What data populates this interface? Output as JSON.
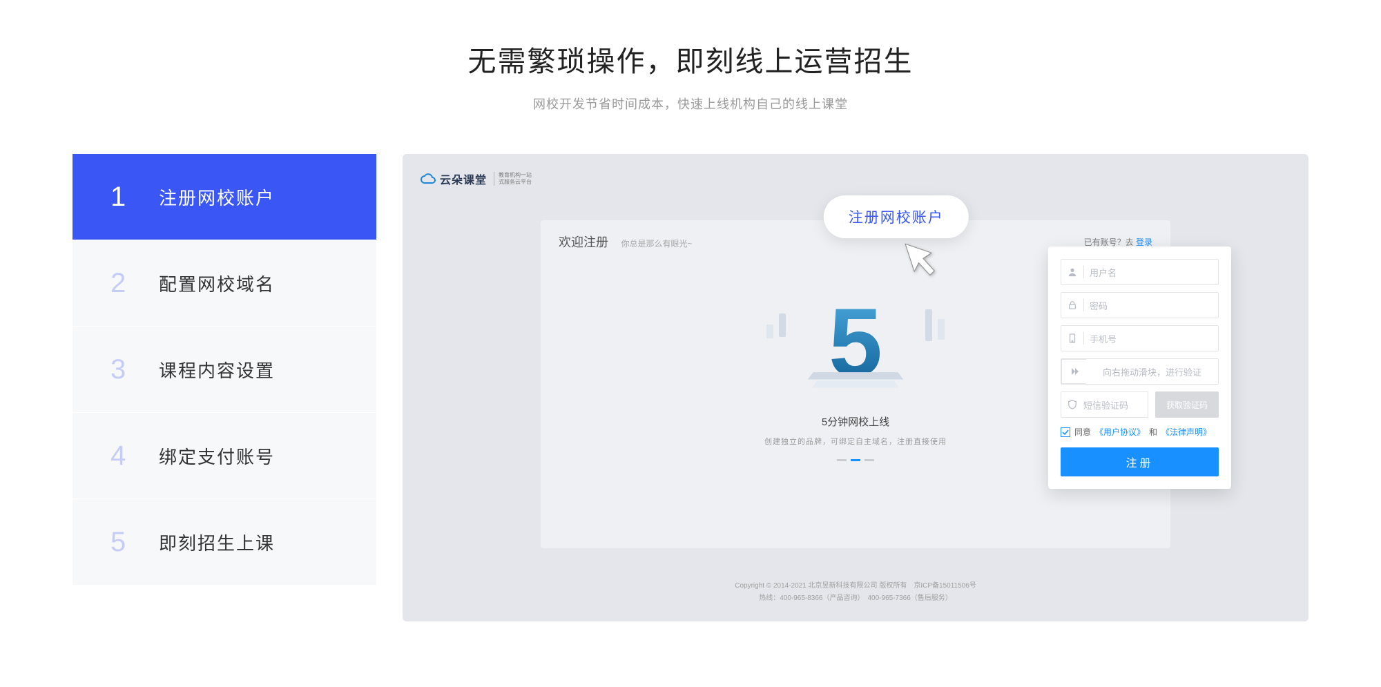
{
  "header": {
    "title": "无需繁琐操作，即刻线上运营招生",
    "subtitle": "网校开发节省时间成本，快速上线机构自己的线上课堂"
  },
  "steps": [
    {
      "num": "1",
      "label": "注册网校账户",
      "active": true
    },
    {
      "num": "2",
      "label": "配置网校域名",
      "active": false
    },
    {
      "num": "3",
      "label": "课程内容设置",
      "active": false
    },
    {
      "num": "4",
      "label": "绑定支付账号",
      "active": false
    },
    {
      "num": "5",
      "label": "即刻招生上课",
      "active": false
    }
  ],
  "tooltip": "注册网校账户",
  "preview": {
    "logo_text": "云朵课堂",
    "logo_sub": "教育机构一站\n式服务云平台",
    "welcome": "欢迎注册",
    "slogan": "你总是那么有眼光~",
    "already": "已有账号？去",
    "login": "登录",
    "center_title": "5分钟网校上线",
    "center_desc": "创建独立的品牌，可绑定自主域名，注册直接使用",
    "footer_line1": "Copyright © 2014-2021 北京昱新科技有限公司 版权所有　京ICP备15011506号",
    "footer_line2": "热线：400-965-8366（产品咨询）　400-965-7366（售后服务）"
  },
  "form": {
    "username_ph": "用户名",
    "password_ph": "密码",
    "phone_ph": "手机号",
    "slider_text": "向右拖动滑块，进行验证",
    "code_ph": "短信验证码",
    "code_btn": "获取验证码",
    "agree_prefix": "同意",
    "agree_link1": "《用户协议》",
    "agree_and": "和",
    "agree_link2": "《法律声明》",
    "submit": "注册"
  }
}
